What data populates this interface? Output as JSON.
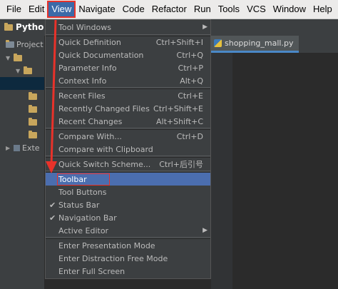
{
  "menubar": {
    "items": [
      "File",
      "Edit",
      "View",
      "Navigate",
      "Code",
      "Refactor",
      "Run",
      "Tools",
      "VCS",
      "Window",
      "Help"
    ]
  },
  "nav": {
    "project_crumb": "Pytho"
  },
  "project_panel": {
    "header": "Project",
    "external_label": "Exte"
  },
  "editor": {
    "tab_label": "shopping_mall.py"
  },
  "view_menu": {
    "items": [
      {
        "label": "Tool Windows",
        "shortcut": "",
        "submenu": true,
        "checked": false
      },
      {
        "label": "Quick Definition",
        "shortcut": "Ctrl+Shift+I",
        "submenu": false,
        "checked": false
      },
      {
        "label": "Quick Documentation",
        "shortcut": "Ctrl+Q",
        "submenu": false,
        "checked": false
      },
      {
        "label": "Parameter Info",
        "shortcut": "Ctrl+P",
        "submenu": false,
        "checked": false
      },
      {
        "label": "Context Info",
        "shortcut": "Alt+Q",
        "submenu": false,
        "checked": false
      },
      {
        "label": "Recent Files",
        "shortcut": "Ctrl+E",
        "submenu": false,
        "checked": false
      },
      {
        "label": "Recently Changed Files",
        "shortcut": "Ctrl+Shift+E",
        "submenu": false,
        "checked": false
      },
      {
        "label": "Recent Changes",
        "shortcut": "Alt+Shift+C",
        "submenu": false,
        "checked": false
      },
      {
        "label": "Compare With...",
        "shortcut": "Ctrl+D",
        "submenu": false,
        "checked": false
      },
      {
        "label": "Compare with Clipboard",
        "shortcut": "",
        "submenu": false,
        "checked": false
      },
      {
        "label": "Quick Switch Scheme...",
        "shortcut": "Ctrl+后引号",
        "submenu": false,
        "checked": false
      },
      {
        "label": "Toolbar",
        "shortcut": "",
        "submenu": false,
        "checked": false
      },
      {
        "label": "Tool Buttons",
        "shortcut": "",
        "submenu": false,
        "checked": false
      },
      {
        "label": "Status Bar",
        "shortcut": "",
        "submenu": false,
        "checked": true
      },
      {
        "label": "Navigation Bar",
        "shortcut": "",
        "submenu": false,
        "checked": true
      },
      {
        "label": "Active Editor",
        "shortcut": "",
        "submenu": true,
        "checked": false
      },
      {
        "label": "Enter Presentation Mode",
        "shortcut": "",
        "submenu": false,
        "checked": false
      },
      {
        "label": "Enter Distraction Free Mode",
        "shortcut": "",
        "submenu": false,
        "checked": false
      },
      {
        "label": "Enter Full Screen",
        "shortcut": "",
        "submenu": false,
        "checked": false
      }
    ]
  },
  "colors": {
    "menu_bg": "#3c3f41",
    "highlight": "#4b6eaf",
    "annotation_red": "#e8322a"
  }
}
